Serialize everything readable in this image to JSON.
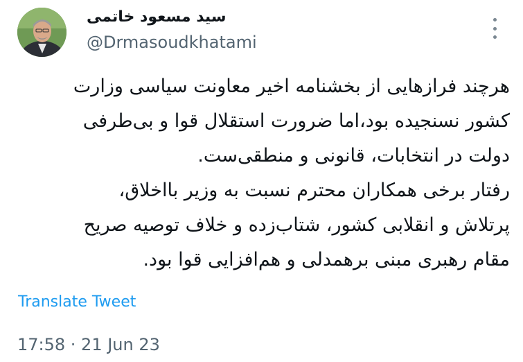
{
  "author": {
    "display_name": "سید مسعود خاتمی",
    "handle": "@Drmasoudkhatami",
    "avatar": "profile-photo"
  },
  "menu_icon": "more-vertical-icon",
  "tweet": {
    "lines": [
      "هرچند فرازهایی از بخشنامه اخیر معاونت سیاسی وزارت",
      "کشور نسنجیده بود،اما ضرورت استقلال قوا و بی‌طرفی",
      "دولت در انتخابات، قانونی و منطقی‌ست.",
      "رفتار برخی همکاران محترم نسبت به وزیر بااخلاق،",
      "پرتلاش و انقلابی کشور، شتاب‌زده و خلاف توصیه صریح",
      "مقام رهبری مبنی برهمدلی و هم‌افزایی قوا بود."
    ]
  },
  "translate_label": "Translate Tweet",
  "timestamp": "17:58 · 21 Jun 23",
  "colors": {
    "link": "#1d9bf0",
    "secondary_text": "#536471",
    "primary_text": "#0f1419"
  }
}
